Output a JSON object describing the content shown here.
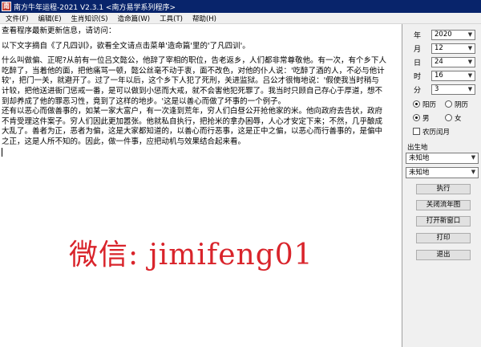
{
  "window": {
    "title": "南方牛年运程-2021  V2.3.1  <南方易学系列程序>",
    "icon_text": "南"
  },
  "menu": [
    "文件(F)",
    "编辑(E)",
    "生肖知识(S)",
    "造命篇(W)",
    "工具(T)",
    "帮助(H)"
  ],
  "content": {
    "lines": [
      "查看程序最新更新信息，请访问：",
      "",
      "以下文字摘自《了凡四训》，欲看全文请点击菜单'造命篇'里的'了凡四训'。",
      "",
      "什么叫做偏、正呢?从前有一位吕文懿公，他辞了宰相的职位，告老返乡，人们都非常尊敬他。有一次，有个乡下人",
      "吃醉了，当着他的面，把他痛骂一顿，懿公丝毫不动于衷，面不改色，对他的仆人说：'吃醉了酒的人，不必与他计",
      "较'，把门一关，就避开了。过了一年以后，这个乡下人犯了死刑，关进监狱。吕公才很悔地说：'假使我当时稍与",
      "计较，把他送进衙门惩戒一番，是可以做到小惩而大戒，就不会害他犯死罪了。我当时只顾自己存心于厚道，想不",
      "到却养成了他的罪恶习性，竟到了这样的地步。'这是以善心而做了坏事的一个例子。",
      "还有以恶心而做善事的，如某一家大富户，有一次逢到荒年，穷人们白昼公开抢他家的米。他向政府去告状，政府",
      "不肯受理这件案子。穷人们因此更加嚣张。他就私自执行，把抢米的拿办困辱，人心才安定下来；不然，几乎酿成",
      "大乱了。善者为正，恶者为偏，这是大家都知道的，以善心而行恶事，这是正中之偏，以恶心而行善事的，是偏中",
      "之正，这是人所不知的。因此，做一件事，应把动机与效果结合起来看。"
    ],
    "watermark": "微信: jimifeng01"
  },
  "panel": {
    "fields": [
      {
        "label": "年",
        "value": "2020"
      },
      {
        "label": "月",
        "value": "12"
      },
      {
        "label": "日",
        "value": "24"
      },
      {
        "label": "时",
        "value": "16"
      },
      {
        "label": "分",
        "value": "3"
      }
    ],
    "calendar": {
      "solar": "阳历",
      "lunar": "阴历",
      "selected": "solar"
    },
    "gender": {
      "male": "男",
      "female": "女",
      "selected": "male"
    },
    "leap_label": "农历闰月",
    "birthplace_label": "出生地",
    "birthplace_1": "未知地",
    "birthplace_2": "未知地",
    "buttons": [
      "执行",
      "关闭流年图",
      "打开新窗口",
      "打印",
      "退出"
    ]
  },
  "colors": {
    "titlebar": "#08246b",
    "watermark": "#d9242b"
  }
}
